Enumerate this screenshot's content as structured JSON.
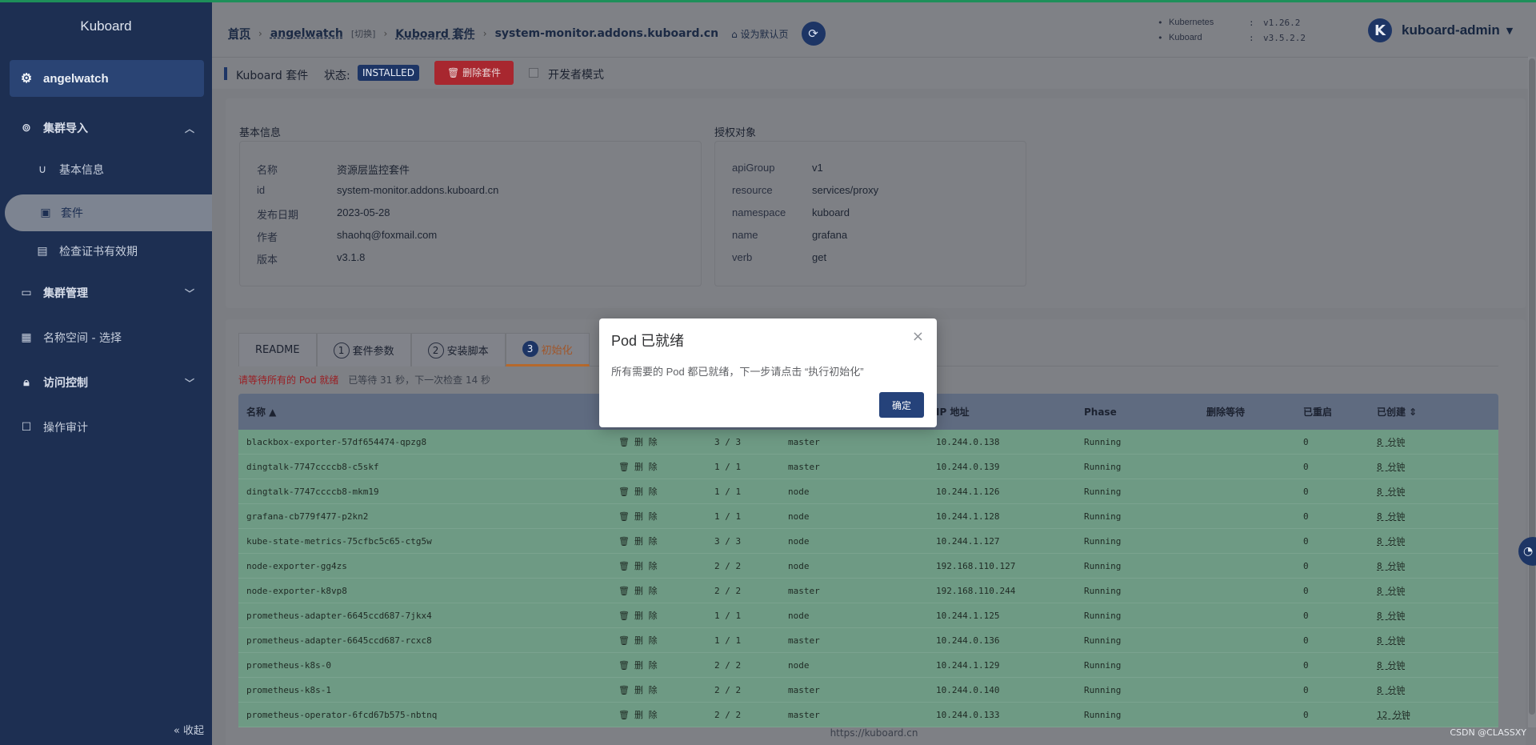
{
  "colors": {
    "sidebar_bg": "#1d2f52",
    "accent": "#1d3565",
    "danger": "#a8272f",
    "row_ok": "#6e9a84",
    "topline": "#1e8f5a"
  },
  "sidebar": {
    "title": "Kuboard",
    "cluster": "angelwatch",
    "items": [
      {
        "label": "集群导入",
        "icon": "link-icon"
      },
      {
        "label": "基本信息",
        "icon": "magnet-icon"
      },
      {
        "label": "套件",
        "icon": "briefcase-icon"
      },
      {
        "label": "检查证书有效期",
        "icon": "certificate-icon"
      },
      {
        "label": "集群管理",
        "icon": "box-icon"
      },
      {
        "label": "名称空间 - 选择",
        "icon": "grid-icon"
      },
      {
        "label": "访问控制",
        "icon": "lock-icon"
      },
      {
        "label": "操作审计",
        "icon": "audit-icon"
      }
    ],
    "collapse": "« 收起"
  },
  "header": {
    "crumbs": {
      "home": "首页",
      "cluster": "angelwatch",
      "switch": "[切换]",
      "suite": "Kuboard 套件",
      "current": "system-monitor.addons.kuboard.cn",
      "set_default": "设为默认页"
    },
    "versions": [
      {
        "name": "Kubernetes",
        "value": "v1.26.2"
      },
      {
        "name": "Kuboard",
        "value": "v3.5.2.2"
      }
    ],
    "user": {
      "initial": "K",
      "name": "kuboard-admin"
    }
  },
  "toolbar": {
    "title": "Kuboard 套件",
    "status_label": "状态:",
    "status": "INSTALLED",
    "delete": "删除套件",
    "dev_mode": "开发者模式"
  },
  "basic": {
    "title": "基本信息",
    "rows": [
      {
        "k": "名称",
        "v": "资源层监控套件"
      },
      {
        "k": "id",
        "v": "system-monitor.addons.kuboard.cn"
      },
      {
        "k": "发布日期",
        "v": "2023-05-28"
      },
      {
        "k": "作者",
        "v": "shaohq@foxmail.com"
      },
      {
        "k": "版本",
        "v": "v3.1.8"
      }
    ]
  },
  "auth": {
    "title": "授权对象",
    "rows": [
      {
        "k": "apiGroup",
        "v": "v1"
      },
      {
        "k": "resource",
        "v": "services/proxy"
      },
      {
        "k": "namespace",
        "v": "kuboard"
      },
      {
        "k": "name",
        "v": "grafana"
      },
      {
        "k": "verb",
        "v": "get"
      }
    ]
  },
  "tabs": [
    {
      "label": "README",
      "num": ""
    },
    {
      "label": "套件参数",
      "num": "1"
    },
    {
      "label": "安装脚本",
      "num": "2"
    },
    {
      "label": "初始化",
      "num": "3"
    }
  ],
  "wait": {
    "msg": "请等待所有的 Pod 就绪",
    "detail": "已等待 31 秒，下一次检查 14 秒"
  },
  "table": {
    "headers": {
      "name": "名称 ▲",
      "ip": "IP 地址",
      "phase": "Phase",
      "del_wait": "删除等待",
      "restarts": "已重启",
      "created": "已创建 ⇕"
    },
    "delete_label": "删 除",
    "rows": [
      {
        "name": "blackbox-exporter-57df654474-qpzg8",
        "ready": "3 / 3",
        "node": "master",
        "ip": "10.244.0.138",
        "phase": "Running",
        "restarts": "0",
        "age": "8 分钟"
      },
      {
        "name": "dingtalk-7747ccccb8-c5skf",
        "ready": "1 / 1",
        "node": "master",
        "ip": "10.244.0.139",
        "phase": "Running",
        "restarts": "0",
        "age": "8 分钟"
      },
      {
        "name": "dingtalk-7747ccccb8-mkm19",
        "ready": "1 / 1",
        "node": "node",
        "ip": "10.244.1.126",
        "phase": "Running",
        "restarts": "0",
        "age": "8 分钟"
      },
      {
        "name": "grafana-cb779f477-p2kn2",
        "ready": "1 / 1",
        "node": "node",
        "ip": "10.244.1.128",
        "phase": "Running",
        "restarts": "0",
        "age": "8 分钟"
      },
      {
        "name": "kube-state-metrics-75cfbc5c65-ctg5w",
        "ready": "3 / 3",
        "node": "node",
        "ip": "10.244.1.127",
        "phase": "Running",
        "restarts": "0",
        "age": "8 分钟"
      },
      {
        "name": "node-exporter-gg4zs",
        "ready": "2 / 2",
        "node": "node",
        "ip": "192.168.110.127",
        "phase": "Running",
        "restarts": "0",
        "age": "8 分钟"
      },
      {
        "name": "node-exporter-k8vp8",
        "ready": "2 / 2",
        "node": "master",
        "ip": "192.168.110.244",
        "phase": "Running",
        "restarts": "0",
        "age": "8 分钟"
      },
      {
        "name": "prometheus-adapter-6645ccd687-7jkx4",
        "ready": "1 / 1",
        "node": "node",
        "ip": "10.244.1.125",
        "phase": "Running",
        "restarts": "0",
        "age": "8 分钟"
      },
      {
        "name": "prometheus-adapter-6645ccd687-rcxc8",
        "ready": "1 / 1",
        "node": "master",
        "ip": "10.244.0.136",
        "phase": "Running",
        "restarts": "0",
        "age": "8 分钟"
      },
      {
        "name": "prometheus-k8s-0",
        "ready": "2 / 2",
        "node": "node",
        "ip": "10.244.1.129",
        "phase": "Running",
        "restarts": "0",
        "age": "8 分钟"
      },
      {
        "name": "prometheus-k8s-1",
        "ready": "2 / 2",
        "node": "master",
        "ip": "10.244.0.140",
        "phase": "Running",
        "restarts": "0",
        "age": "8 分钟"
      },
      {
        "name": "prometheus-operator-6fcd67b575-nbtnq",
        "ready": "2 / 2",
        "node": "master",
        "ip": "10.244.0.133",
        "phase": "Running",
        "restarts": "0",
        "age": "12 分钟"
      }
    ]
  },
  "footer": {
    "url": "https://kuboard.cn",
    "watermark": "CSDN @CLASSXY"
  },
  "modal": {
    "title": "Pod 已就绪",
    "body": "所有需要的 Pod 都已就绪，下一步请点击 “执行初始化”",
    "ok": "确定",
    "close": "×"
  }
}
